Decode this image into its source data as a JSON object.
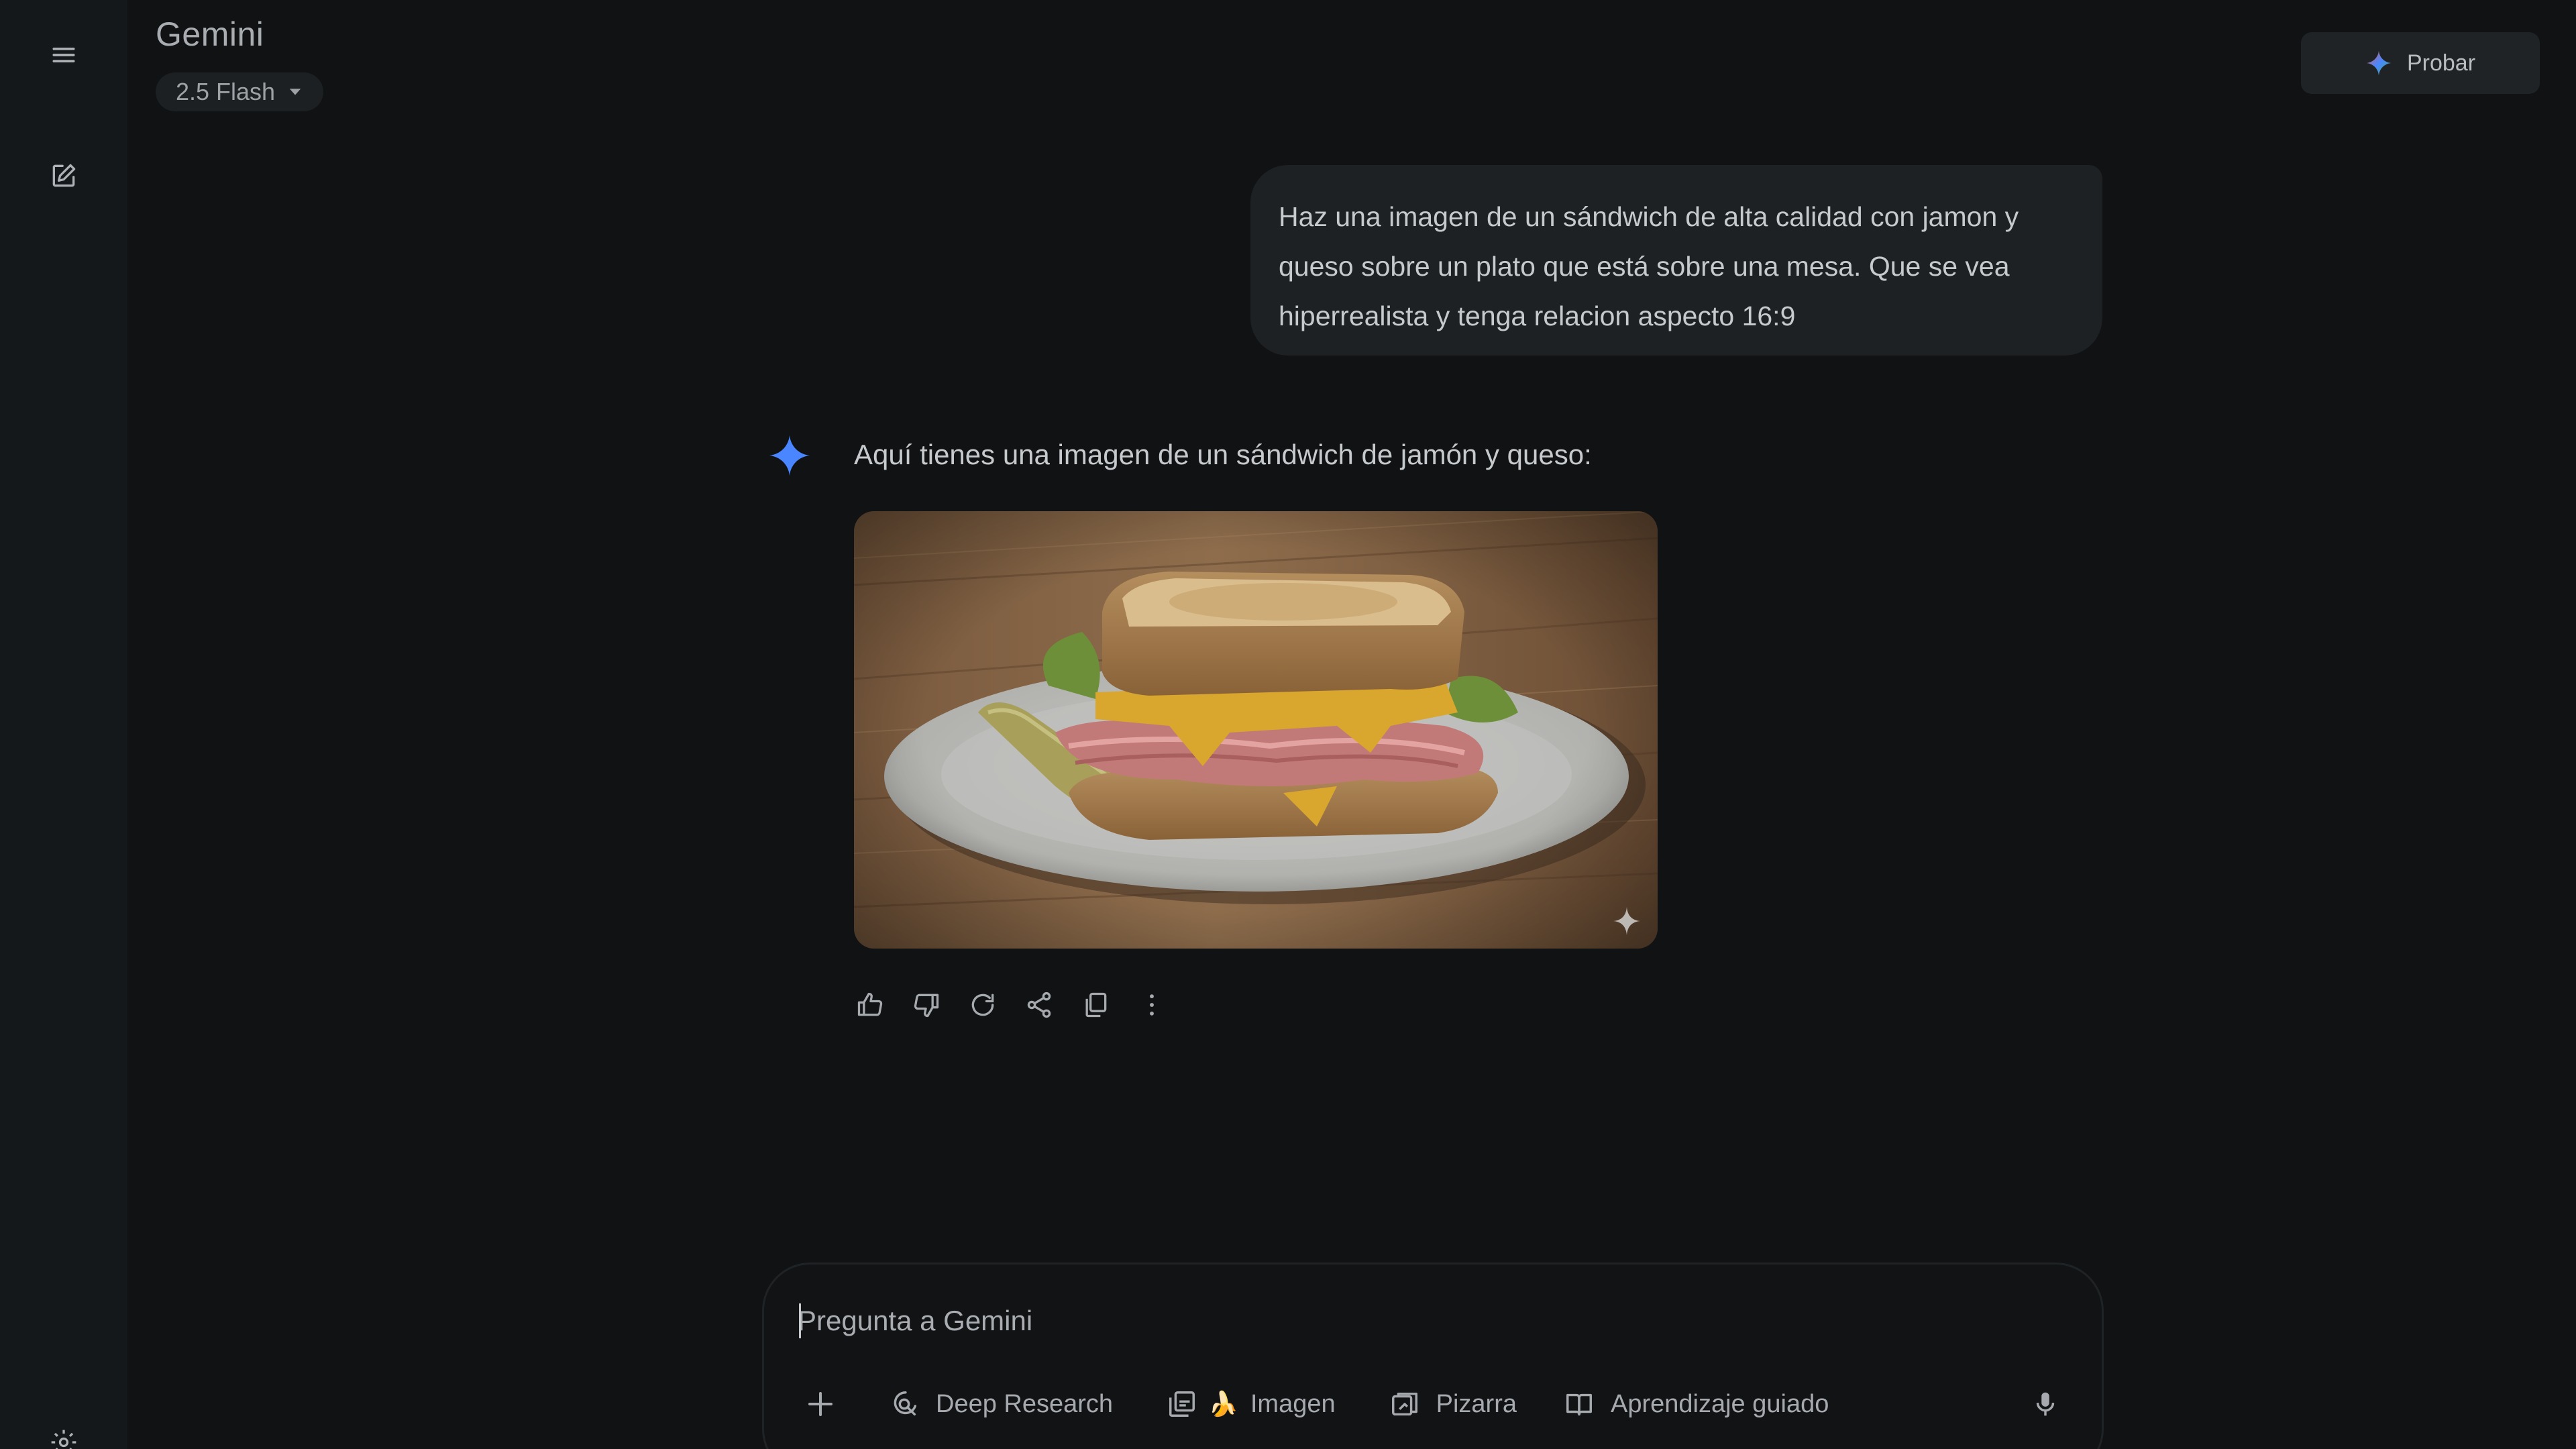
{
  "sidebar": {
    "menu_icon": "hamburger-menu-icon",
    "new_chat_icon": "edit-pencil-icon",
    "settings_icon": "gear-icon"
  },
  "header": {
    "title": "Gemini",
    "model": "2.5 Flash",
    "try_button": "Probar"
  },
  "conversation": {
    "user_message": "Haz una imagen de un sándwich de alta calidad con jamon y queso sobre un plato que está sobre una mesa. Que se vea hiperrealista y tenga relacion aspecto 16:9",
    "response_text": "Aquí tienes una imagen de un sándwich de jamón y queso:",
    "response_actions": [
      "thumbs-up-icon",
      "thumbs-down-icon",
      "regenerate-icon",
      "share-icon",
      "copy-icon",
      "more-vert-icon"
    ]
  },
  "composer": {
    "placeholder": "Pregunta a Gemini",
    "tools": {
      "deep_research": "Deep Research",
      "image": "Imagen",
      "canvas": "Pizarra",
      "guided_learning": "Aprendizaje guiado"
    }
  },
  "colors": {
    "background": "#101213",
    "sidebar": "#15181a",
    "bubble": "#1d2124",
    "gemini_blue": "#4a86ff"
  }
}
